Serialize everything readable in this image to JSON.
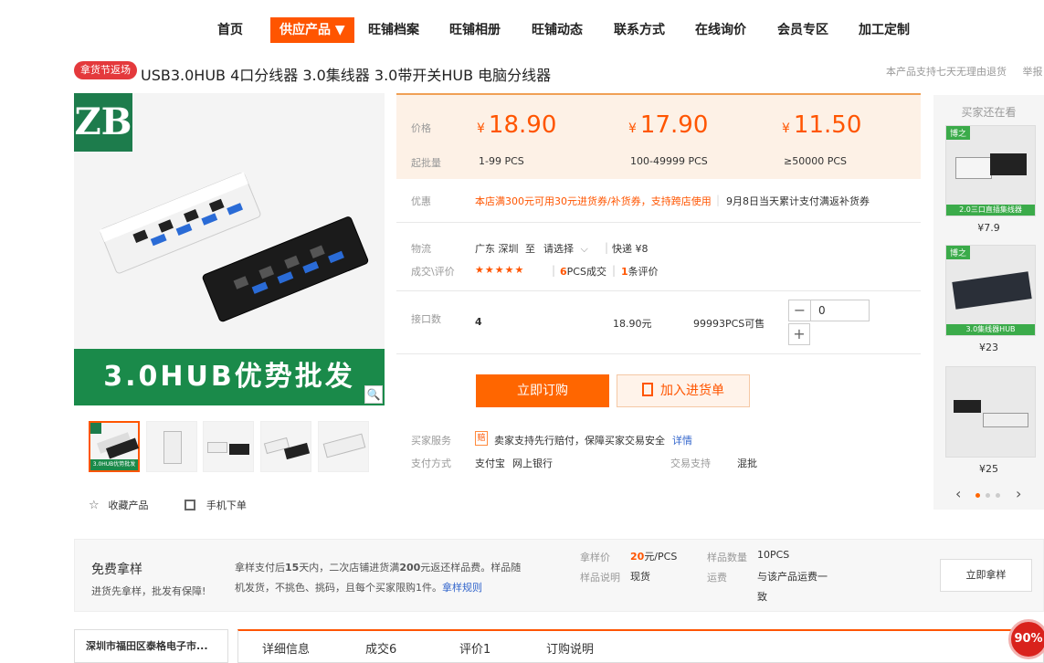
{
  "nav": [
    "首页",
    "供应产品 ▼",
    "旺铺档案",
    "旺铺相册",
    "旺铺动态",
    "联系方式",
    "在线询价",
    "会员专区",
    "加工定制"
  ],
  "product": {
    "badge": "拿货节返场",
    "title": "USB3.0HUB 4口分线器 3.0集线器 3.0带开关HUB 电脑分线器",
    "guarantee": "本产品支持七天无理由退货",
    "report": "举报",
    "banner_text": "3.0HUB优势批发",
    "logo_text": "ZB",
    "thumb_caption": "3.0HUB优势批发"
  },
  "pricing": {
    "price_label": "价格",
    "moq_label": "起批量",
    "currency": "¥",
    "tiers": [
      {
        "price": "18.90",
        "range": "1-99 PCS"
      },
      {
        "price": "17.90",
        "range": "100-49999 PCS"
      },
      {
        "price": "11.50",
        "range": "≥50000 PCS"
      }
    ]
  },
  "promo": {
    "label": "优惠",
    "text": "本店满300元可用30元进货券/补货券，支持跨店使用",
    "text2": "9月8日当天累计支付满返补货券"
  },
  "logistics": {
    "label": "物流",
    "from": "广东 深圳",
    "to": "至",
    "select": "请选择",
    "express": "快递 ¥8"
  },
  "deals": {
    "label": "成交\\评价",
    "stars": "★★★★★",
    "sold_num": "6",
    "sold_unit": "PCS成交",
    "reviews_num": "1",
    "reviews_unit": "条评价"
  },
  "spec": {
    "label": "接口数",
    "value": "4",
    "price": "18.90元",
    "stock": "99993PCS可售",
    "qty": "0"
  },
  "actions": {
    "buy": "立即订购",
    "cart": "加入进货单"
  },
  "service": {
    "label": "买家服务",
    "icon_text": "赔",
    "text": "卖家支持先行赔付，保障买家交易安全",
    "link": "详情",
    "pay_label": "支付方式",
    "pay1": "支付宝",
    "pay2": "网上银行",
    "trade_label": "交易支持",
    "trade_val": "混批"
  },
  "fav": {
    "collect": "收藏产品",
    "mobile": "手机下单"
  },
  "sidebar": {
    "title": "买家还在看",
    "items": [
      {
        "tag": "博之",
        "caption": "2.0三口直插集线器",
        "price": "¥7.9"
      },
      {
        "tag": "博之",
        "caption": "3.0集线器HUB",
        "price": "¥23"
      },
      {
        "tag": "",
        "caption": "",
        "price": "¥25"
      }
    ]
  },
  "sample": {
    "title": "免费拿样",
    "subtitle": "进货先拿样，批发有保障!",
    "desc1a": "拿样支付后",
    "desc1b": "15",
    "desc1c": "天内，二次店铺进货满",
    "desc1d": "200",
    "desc1e": "元返还样品费。样品随",
    "desc2": "机发货，不挑色、挑码，且每个买家限购1件。",
    "desc_link": "拿样规则",
    "price_label": "拿样价",
    "price_num": "20",
    "price_unit": "元/PCS",
    "qty_label": "样品数量",
    "qty_val": "10PCS",
    "note_label": "样品说明",
    "note_val": "现货",
    "ship_label": "运费",
    "ship_val1": "与该产品运费一",
    "ship_val2": "致",
    "button": "立即拿样"
  },
  "shop_name": "深圳市福田区泰格电子市...",
  "tabs": [
    "详细信息",
    "成交6",
    "评价1",
    "订购说明"
  ],
  "progress": "90%",
  "colors": {
    "accent": "#ff5500",
    "green": "#1a8a4a"
  }
}
